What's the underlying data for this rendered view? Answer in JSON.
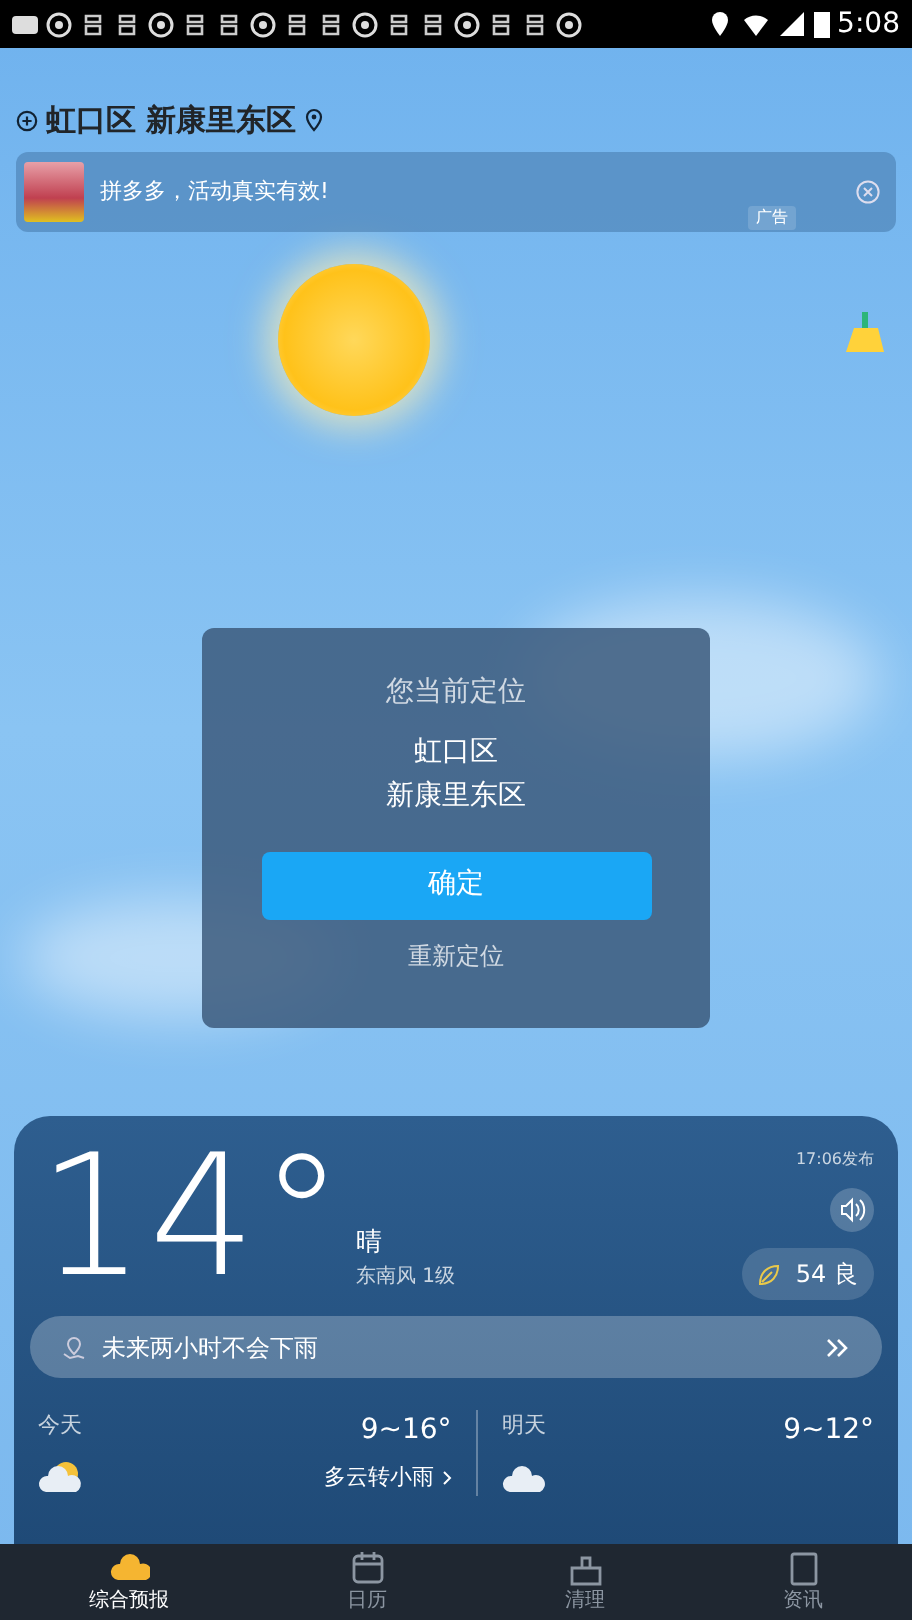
{
  "status_bar": {
    "time": "5:08"
  },
  "location": {
    "title": "虹口区 新康里东区"
  },
  "ad": {
    "text": "拼多多，活动真实有效!",
    "tag": "广告"
  },
  "dialog": {
    "title": "您当前定位",
    "lines": [
      "虹口区",
      "新康里东区"
    ],
    "confirm": "确定",
    "relocate": "重新定位"
  },
  "weather": {
    "temperature": "14°",
    "condition": "晴",
    "wind": "东南风 1级",
    "published": "17:06发布",
    "aqi": "54 良",
    "rain_notice": "未来两小时不会下雨",
    "days": [
      {
        "label": "今天",
        "range": "9~16°",
        "desc": "多云转小雨"
      },
      {
        "label": "明天",
        "range": "9~12°"
      }
    ]
  },
  "tabs": [
    {
      "label": "综合预报",
      "selected": true
    },
    {
      "label": "日历",
      "selected": false
    },
    {
      "label": "清理",
      "selected": false
    },
    {
      "label": "资讯",
      "selected": false
    }
  ]
}
